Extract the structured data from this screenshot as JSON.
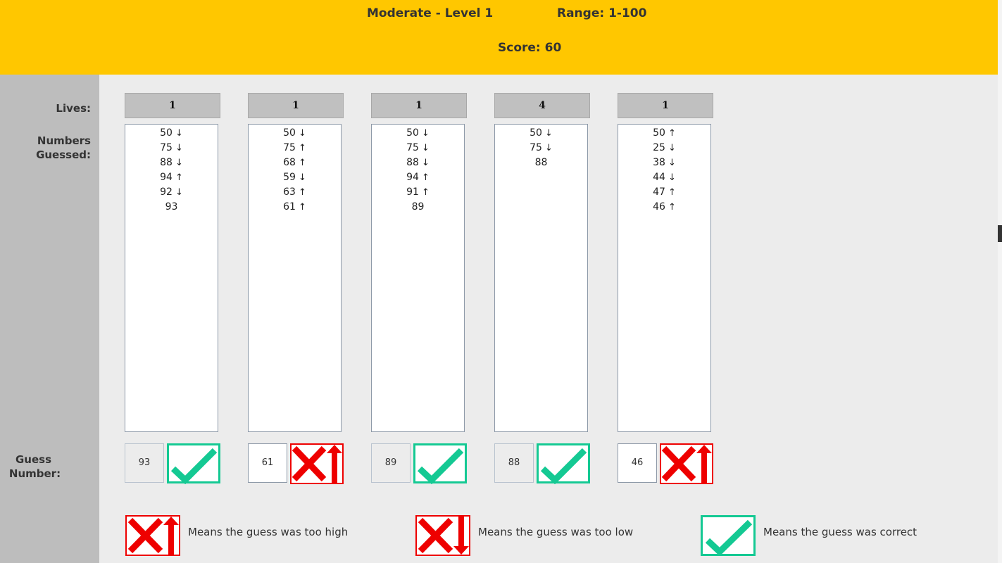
{
  "header": {
    "level": "Moderate - Level 1",
    "range": "Range: 1-100",
    "score": "Score: 60"
  },
  "labels": {
    "lives": "Lives:",
    "numbers_guessed_line1": "Numbers",
    "numbers_guessed_line2": "Guessed:",
    "guess_number_line1": "Guess",
    "guess_number_line2": "Number:"
  },
  "columns": [
    {
      "lives": "1",
      "guesses": [
        {
          "value": "50",
          "arrow": "↓"
        },
        {
          "value": "75",
          "arrow": "↓"
        },
        {
          "value": "88",
          "arrow": "↓"
        },
        {
          "value": "94",
          "arrow": "↑"
        },
        {
          "value": "92",
          "arrow": "↓"
        },
        {
          "value": "93",
          "arrow": ""
        }
      ],
      "current_guess": "93",
      "result": "correct",
      "input_enabled": false
    },
    {
      "lives": "1",
      "guesses": [
        {
          "value": "50",
          "arrow": "↓"
        },
        {
          "value": "75",
          "arrow": "↑"
        },
        {
          "value": "68",
          "arrow": "↑"
        },
        {
          "value": "59",
          "arrow": "↓"
        },
        {
          "value": "63",
          "arrow": "↑"
        },
        {
          "value": "61",
          "arrow": "↑"
        }
      ],
      "current_guess": "61",
      "result": "too-high",
      "input_enabled": true
    },
    {
      "lives": "1",
      "guesses": [
        {
          "value": "50",
          "arrow": "↓"
        },
        {
          "value": "75",
          "arrow": "↓"
        },
        {
          "value": "88",
          "arrow": "↓"
        },
        {
          "value": "94",
          "arrow": "↑"
        },
        {
          "value": "91",
          "arrow": "↑"
        },
        {
          "value": "89",
          "arrow": ""
        }
      ],
      "current_guess": "89",
      "result": "correct",
      "input_enabled": false
    },
    {
      "lives": "4",
      "guesses": [
        {
          "value": "50",
          "arrow": "↓"
        },
        {
          "value": "75",
          "arrow": "↓"
        },
        {
          "value": "88",
          "arrow": ""
        }
      ],
      "current_guess": "88",
      "result": "correct",
      "input_enabled": false
    },
    {
      "lives": "1",
      "guesses": [
        {
          "value": "50",
          "arrow": "↑"
        },
        {
          "value": "25",
          "arrow": "↓"
        },
        {
          "value": "38",
          "arrow": "↓"
        },
        {
          "value": "44",
          "arrow": "↓"
        },
        {
          "value": "47",
          "arrow": "↑"
        },
        {
          "value": "46",
          "arrow": "↑"
        }
      ],
      "current_guess": "46",
      "result": "too-high",
      "input_enabled": true
    }
  ],
  "legend": {
    "too_high": "Means the guess was too high",
    "too_low": "Means the guess was too low",
    "correct": "Means the guess was correct"
  },
  "colors": {
    "header_bg": "#ffc700",
    "sidebar_bg": "#bdbdbd",
    "correct": "#14c993",
    "wrong": "#ee0000"
  }
}
